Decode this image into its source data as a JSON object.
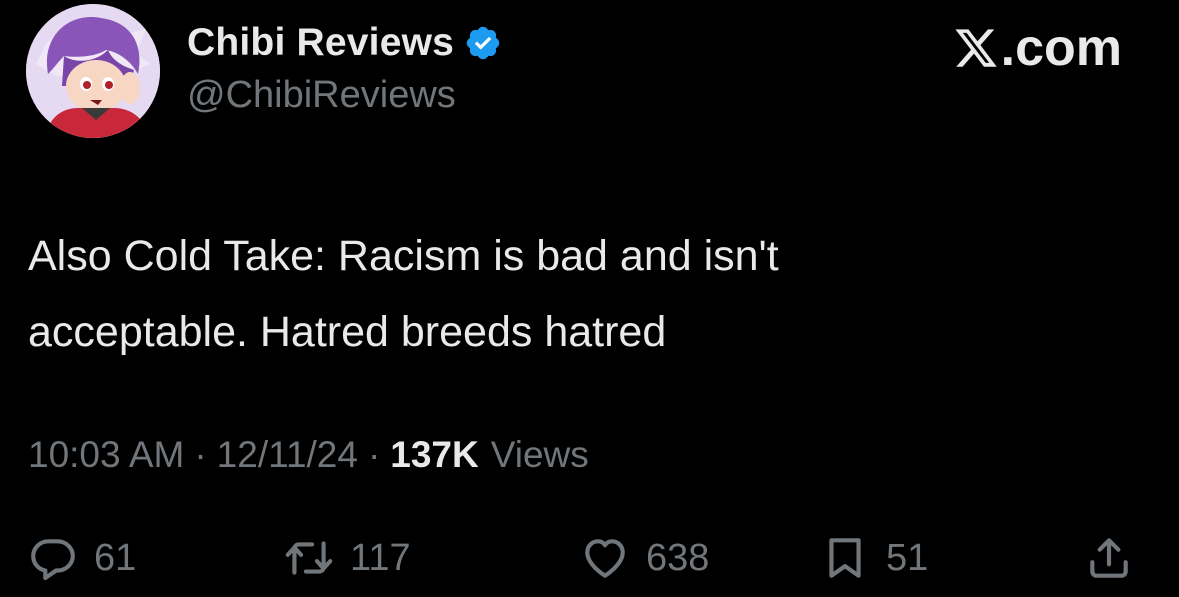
{
  "author": {
    "display_name": "Chibi Reviews",
    "handle": "@ChibiReviews",
    "verified_icon": "verified-badge-icon",
    "avatar_icon": "avatar"
  },
  "brand": {
    "text": ".com",
    "icon": "x-logo-icon"
  },
  "tweet": {
    "lines": [
      "Also Cold Take: Racism is bad and isn't",
      "acceptable. Hatred breeds hatred"
    ]
  },
  "meta": {
    "time": "10:03 AM",
    "separator": "·",
    "date": "12/11/24",
    "views_count": "137K",
    "views_label": "Views"
  },
  "actions": {
    "replies": "61",
    "reposts": "117",
    "likes": "638",
    "bookmarks": "51"
  },
  "colors": {
    "background": "#000000",
    "primary_text": "#e7e9ea",
    "secondary_text": "#71767b",
    "verified_blue": "#1d9bf0"
  }
}
